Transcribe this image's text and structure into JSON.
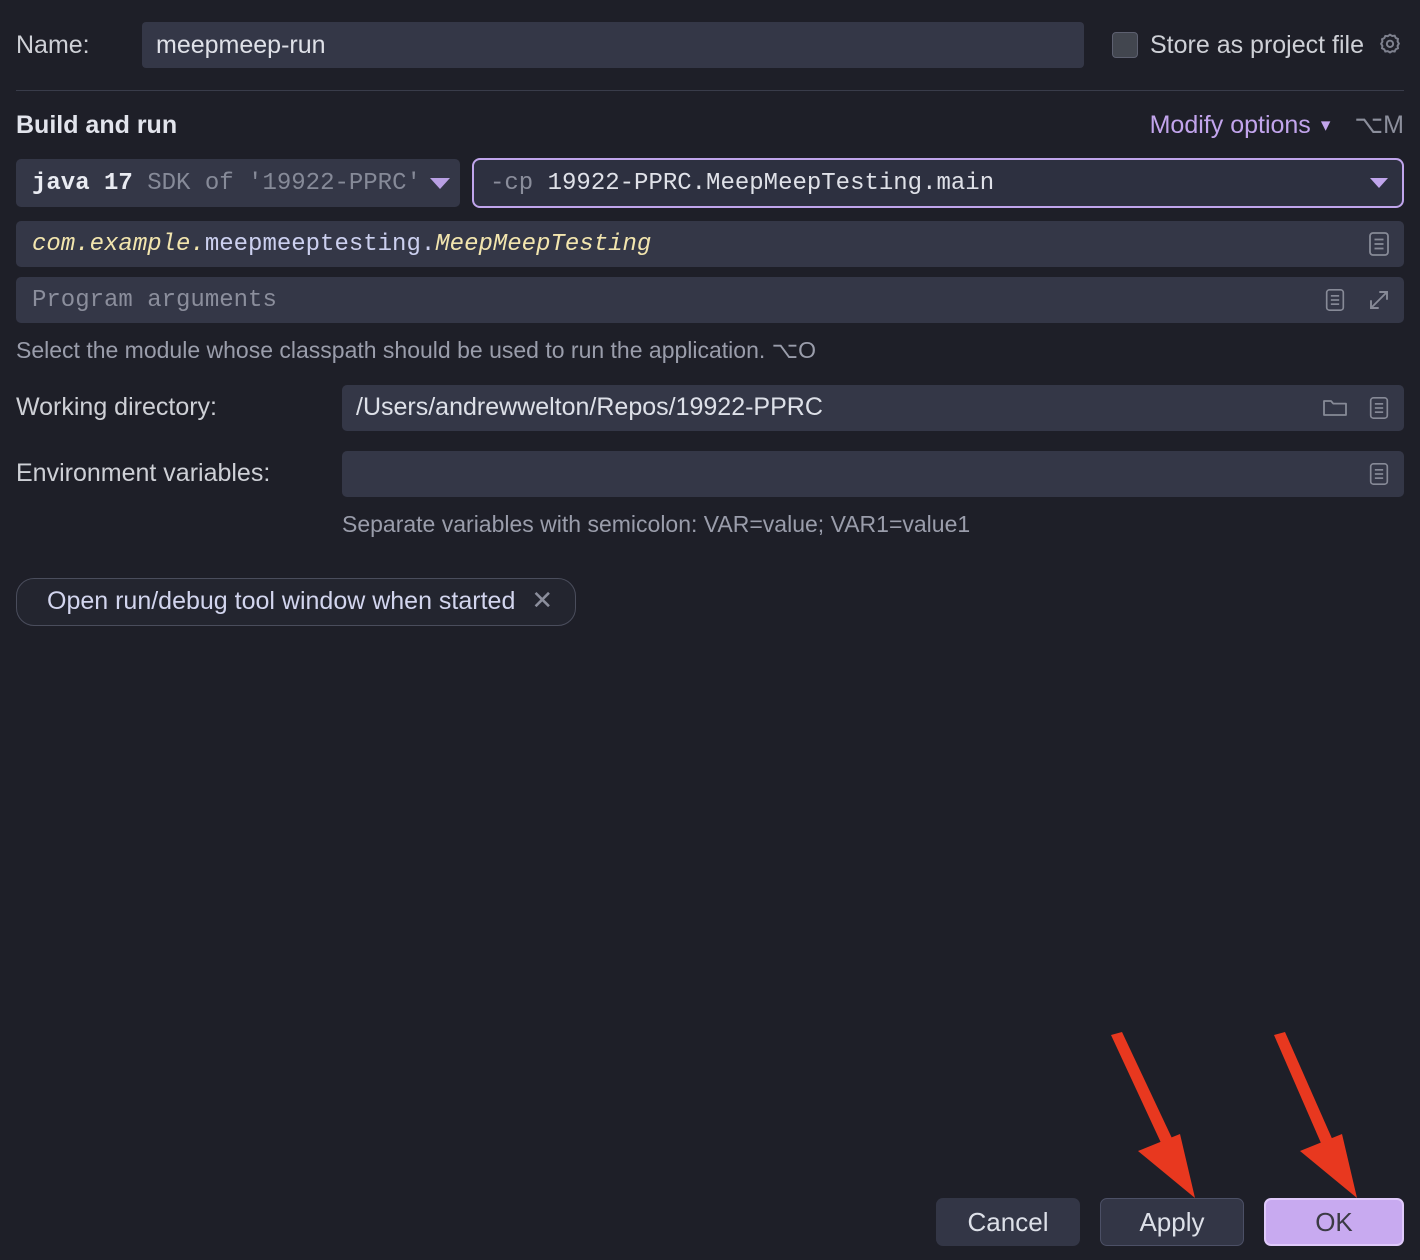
{
  "name_row": {
    "label": "Name:",
    "value": "meepmeep-run",
    "store_as_project_file": "Store as project file",
    "store_checked": false,
    "gear_icon": "gear-icon"
  },
  "build_and_run": {
    "section_title": "Build and run",
    "modify_options": "Modify options",
    "modify_chevron": "chevron-down-icon",
    "modify_shortcut": "⌥M",
    "sdk": {
      "name": "java 17",
      "detail": "SDK of '19922-PPRC'",
      "dropdown_icon": "chevron-down-icon"
    },
    "classpath": {
      "prefix": "-cp",
      "value": "19922-PPRC.MeepMeepTesting.main",
      "dropdown_icon": "chevron-down-icon"
    },
    "main_class": {
      "package": "com.example.",
      "middle": "meepmeeptesting.",
      "class": "MeepMeepTesting",
      "macro_icon": "document-list-icon"
    },
    "program_arguments": {
      "placeholder": "Program arguments",
      "value": "",
      "macro_icon": "document-list-icon",
      "expand_icon": "expand-arrows-icon"
    },
    "module_hint": "Select the module whose classpath should be used to run the application. ⌥O"
  },
  "working_directory": {
    "label": "Working directory:",
    "value": "/Users/andrewwelton/Repos/19922-PPRC",
    "browse_icon": "folder-icon",
    "macro_icon": "document-list-icon"
  },
  "environment_variables": {
    "label": "Environment variables:",
    "value": "",
    "macro_icon": "document-list-icon",
    "hint": "Separate variables with semicolon: VAR=value; VAR1=value1"
  },
  "option_chip": {
    "label": "Open run/debug tool window when started",
    "close_icon": "close-icon"
  },
  "buttons": {
    "cancel": "Cancel",
    "apply": "Apply",
    "ok": "OK"
  },
  "annotations": {
    "arrow_color": "#e8381f",
    "arrow_count": 2,
    "arrow_targets": [
      "Apply",
      "OK"
    ]
  },
  "colors": {
    "background": "#1e1f28",
    "field_background": "#343747",
    "accent_purple": "#c0a5ec",
    "ok_button": "#c8aaf0",
    "text_primary": "#dde0e8",
    "text_muted": "#8b8e9c",
    "string_yellow": "#f2e5ae"
  }
}
